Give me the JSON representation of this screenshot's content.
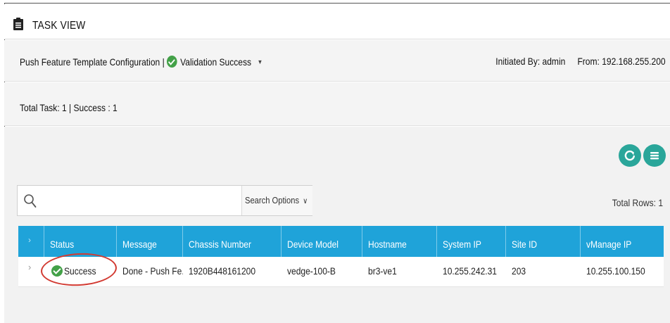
{
  "window": {
    "title": "TASK VIEW",
    "title_icon": "clipboard-icon"
  },
  "task": {
    "name": "Push Feature Template Configuration",
    "separator": "|",
    "validation_status": "Validation Success",
    "validation_icon": "check-circle-icon",
    "dropdown_icon": "caret-down-icon",
    "initiated_by": "Initiated By: admin",
    "from": "From: 192.168.255.200"
  },
  "summary": {
    "text": "Total Task: 1 | Success : 1"
  },
  "toolbar": {
    "refresh_icon": "refresh-icon",
    "menu_icon": "list-menu-icon",
    "total_rows": "Total Rows: 1",
    "accent_color": "#2aa69a"
  },
  "search": {
    "placeholder": "",
    "value": "",
    "options_label": "Search Options",
    "options_chevron": "∨"
  },
  "table": {
    "header_color": "#1fa3d9",
    "expander_glyph": "›",
    "columns": [
      "Status",
      "Message",
      "Chassis Number",
      "Device Model",
      "Hostname",
      "System IP",
      "Site ID",
      "vManage IP"
    ],
    "rows": [
      {
        "status": "Success",
        "message": "Done - Push Fe...",
        "chassis_number": "1920B448161200",
        "device_model": "vedge-100-B",
        "hostname": "br3-ve1",
        "system_ip": "10.255.242.31",
        "site_id": "203",
        "vmanage_ip": "10.255.100.150"
      }
    ]
  },
  "annotation": {
    "highlight_color": "#d23a32"
  }
}
